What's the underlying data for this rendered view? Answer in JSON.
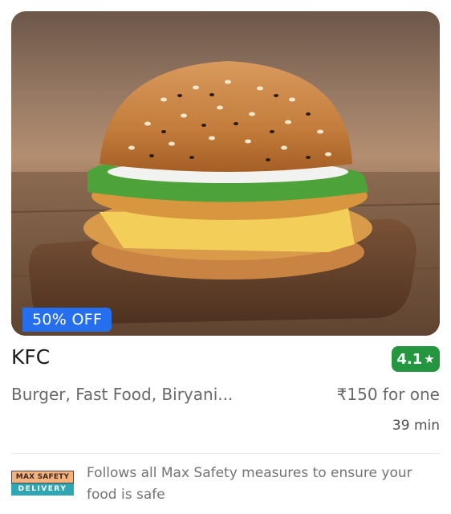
{
  "restaurant": {
    "name": "KFC",
    "rating": "4.1",
    "rating_icon": "star-icon",
    "cuisines": "Burger, Fast Food, Biryani...",
    "price_for_one": "₹150 for one",
    "delivery_time": "39 min",
    "offer": "50% OFF",
    "image_subject": "burger"
  },
  "safety": {
    "logo_top": "MAX SAFETY",
    "logo_bottom": "DELIVERY",
    "message": "Follows all Max Safety measures to ensure your food is safe"
  },
  "colors": {
    "offer_badge": "#256fef",
    "rating_badge": "#24963f"
  }
}
